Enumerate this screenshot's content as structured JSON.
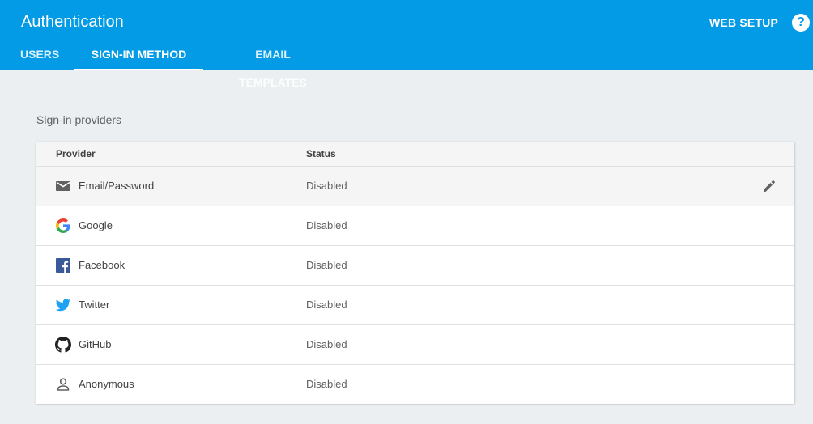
{
  "header": {
    "title": "Authentication",
    "web_setup_label": "WEB SETUP",
    "help_glyph": "?",
    "colors": {
      "bar": "#039be5",
      "text": "#ffffff"
    }
  },
  "tabs": [
    {
      "label": "USERS",
      "active": false
    },
    {
      "label": "SIGN-IN METHOD",
      "active": true
    },
    {
      "label": "EMAIL TEMPLATES",
      "active": false
    }
  ],
  "section": {
    "title": "Sign-in providers"
  },
  "table": {
    "columns": [
      "Provider",
      "Status"
    ],
    "rows": [
      {
        "provider": "Email/Password",
        "status": "Disabled",
        "icon": "email-icon"
      },
      {
        "provider": "Google",
        "status": "Disabled",
        "icon": "google-icon"
      },
      {
        "provider": "Facebook",
        "status": "Disabled",
        "icon": "facebook-icon"
      },
      {
        "provider": "Twitter",
        "status": "Disabled",
        "icon": "twitter-icon"
      },
      {
        "provider": "GitHub",
        "status": "Disabled",
        "icon": "github-icon"
      },
      {
        "provider": "Anonymous",
        "status": "Disabled",
        "icon": "person-icon"
      }
    ],
    "row_action_icon": "pencil-icon"
  }
}
